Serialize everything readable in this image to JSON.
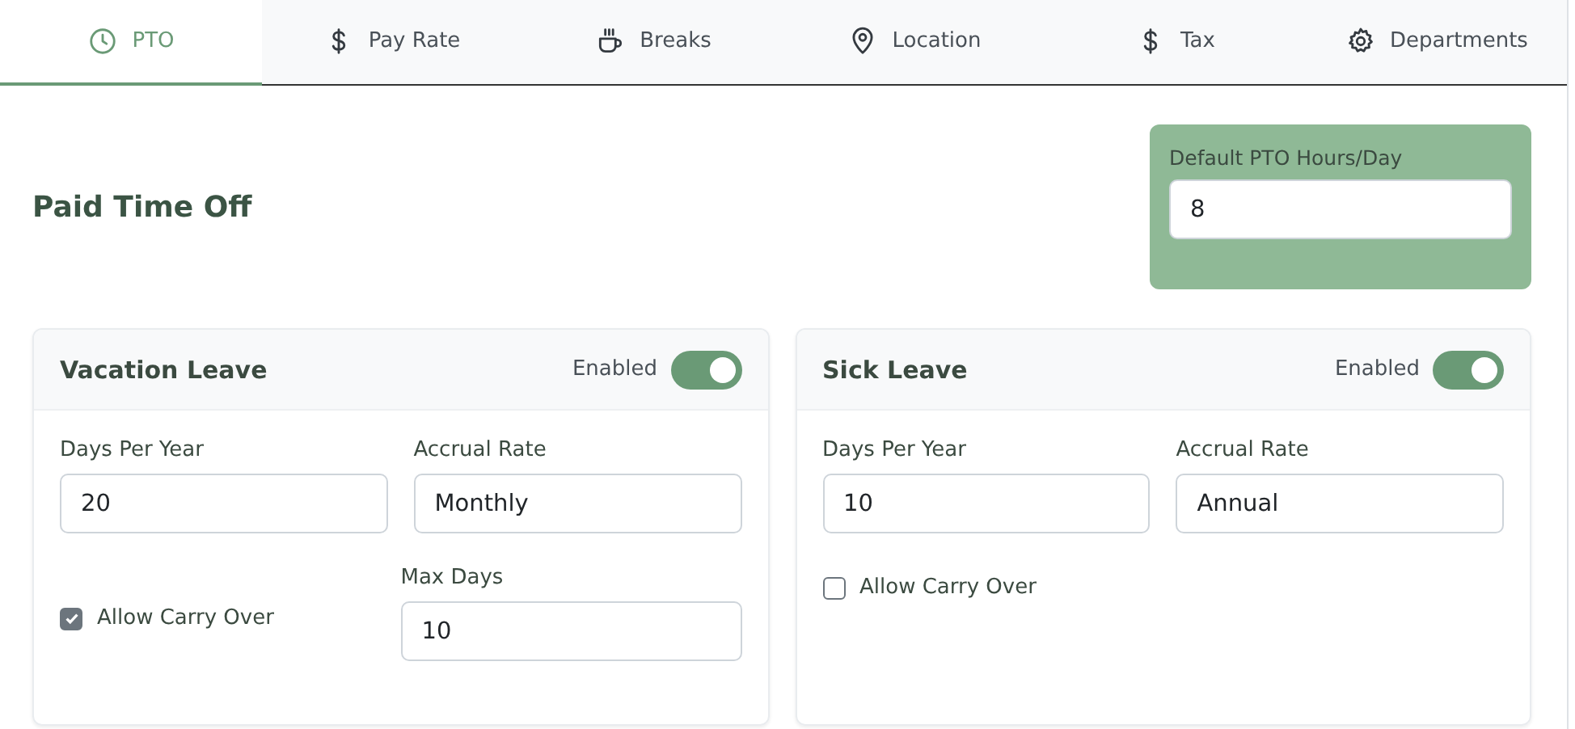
{
  "tabs": [
    {
      "label": "PTO",
      "kind": "clock",
      "selected": true
    },
    {
      "label": "Pay Rate",
      "kind": "dollar",
      "selected": false
    },
    {
      "label": "Breaks",
      "kind": "cup",
      "selected": false
    },
    {
      "label": "Location",
      "kind": "pin",
      "selected": false
    },
    {
      "label": "Tax",
      "kind": "dollar",
      "selected": false
    },
    {
      "label": "Departments",
      "kind": "gear",
      "selected": false
    }
  ],
  "title": "Paid Time Off",
  "default_hours": {
    "label": "Default PTO Hours/Day",
    "value": "8"
  },
  "cards": [
    {
      "title": "Vacation Leave",
      "toggle_label": "Enabled",
      "enabled": true,
      "days": {
        "label": "Days Per Year",
        "value": "20"
      },
      "accrual": {
        "label": "Accrual Rate",
        "value": "Monthly"
      },
      "carry_over": {
        "label": "Allow Carry Over",
        "checked": true
      },
      "max_days": {
        "label": "Max Days",
        "value": "10"
      }
    },
    {
      "title": "Sick Leave",
      "toggle_label": "Enabled",
      "enabled": true,
      "days": {
        "label": "Days Per Year",
        "value": "10"
      },
      "accrual": {
        "label": "Accrual Rate",
        "value": "Annual"
      },
      "carry_over": {
        "label": "Allow Carry Over",
        "checked": false
      }
    }
  ]
}
